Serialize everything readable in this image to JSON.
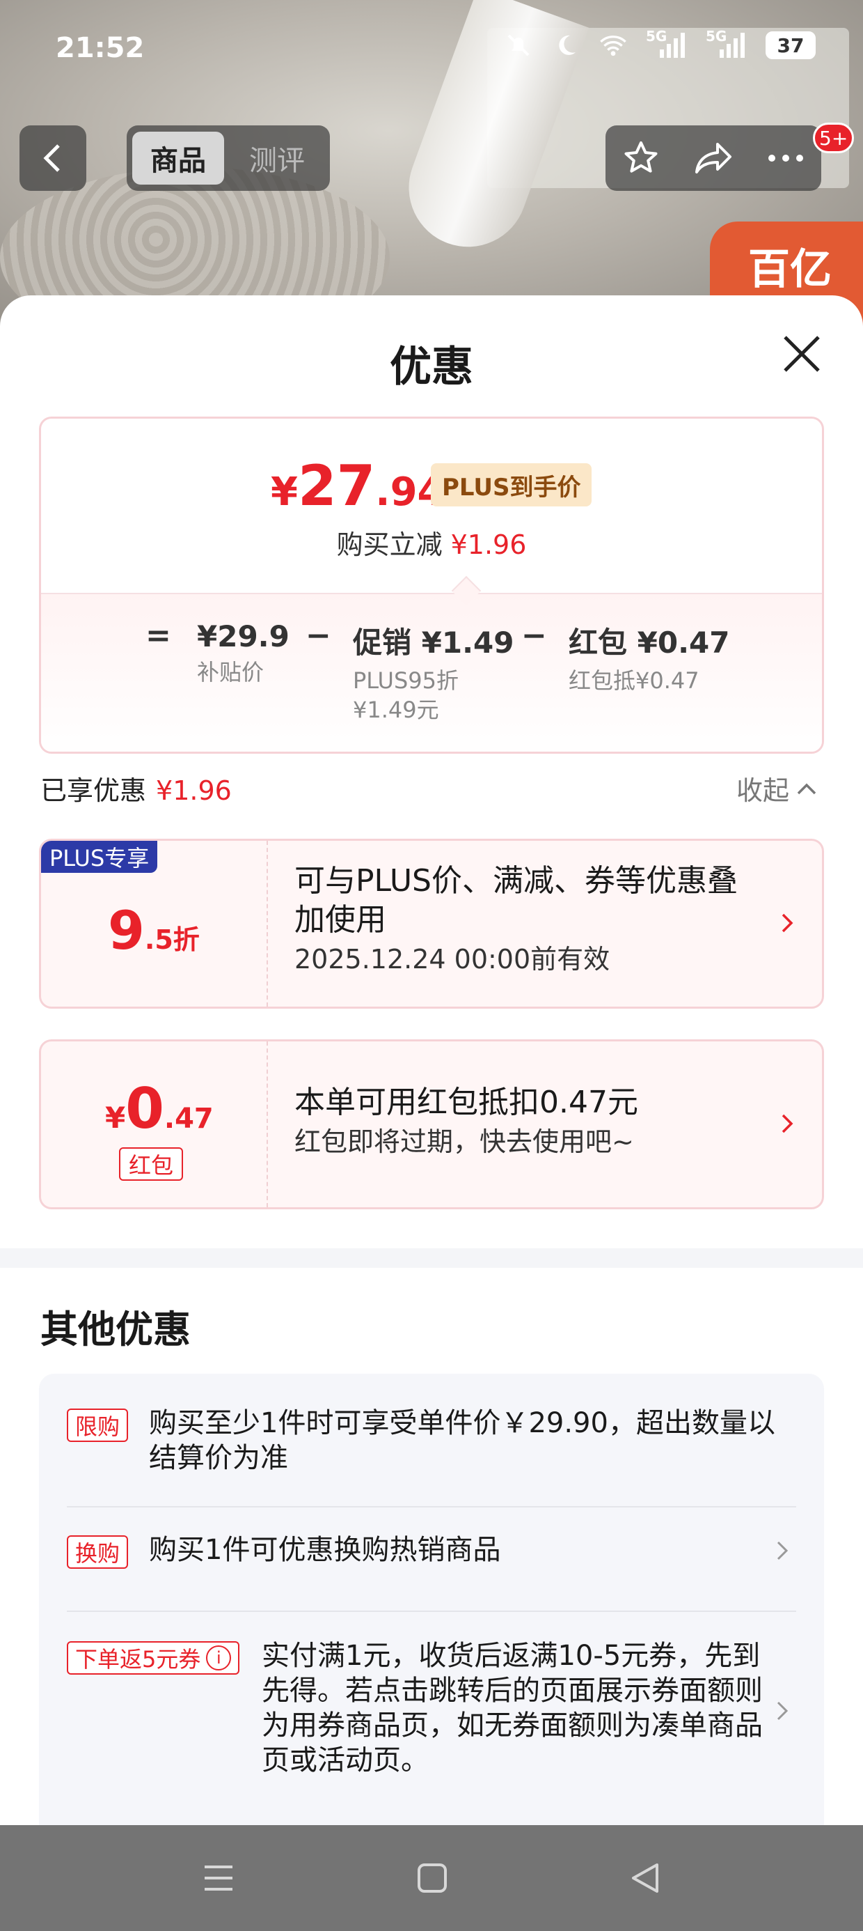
{
  "status_bar": {
    "time": "21:52",
    "signal_1": "5G",
    "signal_2": "5G",
    "battery": "37"
  },
  "nav": {
    "tabs": [
      "商品",
      "测评"
    ],
    "badge": "5+"
  },
  "brand_text": "百亿",
  "sheet": {
    "title": "优惠",
    "price": {
      "currency": "¥",
      "int_part": "27",
      "dec_part": ".94",
      "tag": "PLUS到手价",
      "reduce_label": "购买立减",
      "reduce_amount": "¥1.96"
    },
    "formula": {
      "equals": "=",
      "minus": "−",
      "items": [
        {
          "main": "¥29.9",
          "sub": [
            "补贴价"
          ]
        },
        {
          "main": "促销 ¥1.49",
          "sub": [
            "PLUS95折",
            "¥1.49元"
          ]
        },
        {
          "main": "红包 ¥0.47",
          "sub": [
            "红包抵¥0.47"
          ]
        }
      ]
    },
    "enjoyed": {
      "label": "已享优惠",
      "amount": "¥1.96",
      "collapse": "收起"
    },
    "promo_plus": {
      "label": "PLUS专享",
      "big": "9",
      "small": ".5折",
      "line1": "可与PLUS价、满减、券等优惠叠加使用",
      "line2": "2025.12.24 00:00前有效"
    },
    "promo_redpacket": {
      "currency": "¥",
      "big": "0",
      "small": ".47",
      "tag": "红包",
      "line1": "本单可用红包抵扣0.47元",
      "line2": "红包即将过期，快去使用吧~"
    },
    "other": {
      "title": "其他优惠",
      "rows": [
        {
          "tag": "限购",
          "text": "购买至少1件时可享受单件价￥29.90，超出数量以结算价为准"
        },
        {
          "tag": "换购",
          "text": "购买1件可优惠换购热销商品"
        },
        {
          "tag": "下单返5元券",
          "text": "实付满1元，收货后返满10-5元券，先到先得。若点击跳转后的页面展示券面额则为用券商品页，如无券面额则为凑单商品页或活动页。"
        }
      ]
    }
  },
  "colors": {
    "accent": "#e8222a",
    "plus_blue": "#2c3aa7",
    "gold": "#8b4a0e"
  }
}
